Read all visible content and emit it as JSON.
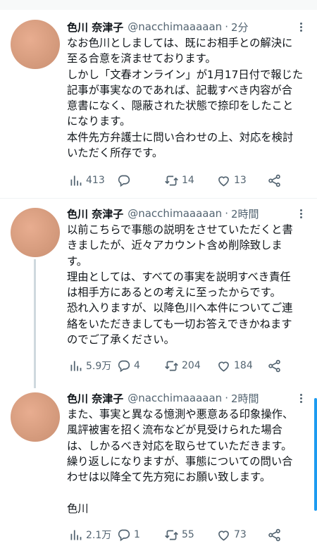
{
  "tweets": [
    {
      "name": "色川 奈津子",
      "handle": "@nacchimaaaaan",
      "time": "2分",
      "lines": [
        "なお色川としましては、既にお相手との解決に",
        "至る合意を済ませております。",
        "しかし「文春オンライン」が1月17日付で報じた",
        "記事が事実なのであれば、記載すべき内容が合",
        "意書になく、隠蔽された状態で捺印をしたこと",
        "になります。",
        "本件先方弁護士に問い合わせの上、対応を検討",
        "いただく所存です。"
      ],
      "views": "413",
      "replies": "",
      "retweets": "14",
      "likes": "13"
    },
    {
      "name": "色川 奈津子",
      "handle": "@nacchimaaaaan",
      "time": "2時間",
      "lines": [
        "以前こちらで事態の説明をさせていただくと書",
        "きましたが、近々アカウント含め削除致しま",
        "す。",
        "理由としては、すべての事実を説明すべき責任",
        "は相手方にあるとの考えに至ったからです。",
        "恐れ入りますが、以降色川へ本件についてご連",
        "絡をいただきましても一切お答えできかねます",
        "のでご了承ください。"
      ],
      "views": "5.9万",
      "replies": "4",
      "retweets": "204",
      "likes": "184"
    },
    {
      "name": "色川 奈津子",
      "handle": "@nacchimaaaaan",
      "time": "2時間",
      "lines": [
        "また、事実と異なる憶測や悪意ある印象操作、",
        "風評被害を招く流布などが見受けられた場合",
        "は、しかるべき対応を取らせていただきます。",
        "繰り返しになりますが、事態についての問い合",
        "わせは以降全て先方宛にお願い致します。",
        "",
        "色川"
      ],
      "views": "2.1万",
      "replies": "1",
      "retweets": "55",
      "likes": "73"
    }
  ],
  "icons": {
    "views": "bar-chart-icon",
    "reply": "speech-bubble-icon",
    "retweet": "retweet-arrows-icon",
    "like": "heart-icon",
    "share": "share-nodes-icon",
    "more": "more-dots-icon"
  },
  "colors": {
    "text": "#0f1419",
    "secondary": "#536471",
    "accent": "#1d9bf0",
    "avatar": "#d59b7d"
  }
}
